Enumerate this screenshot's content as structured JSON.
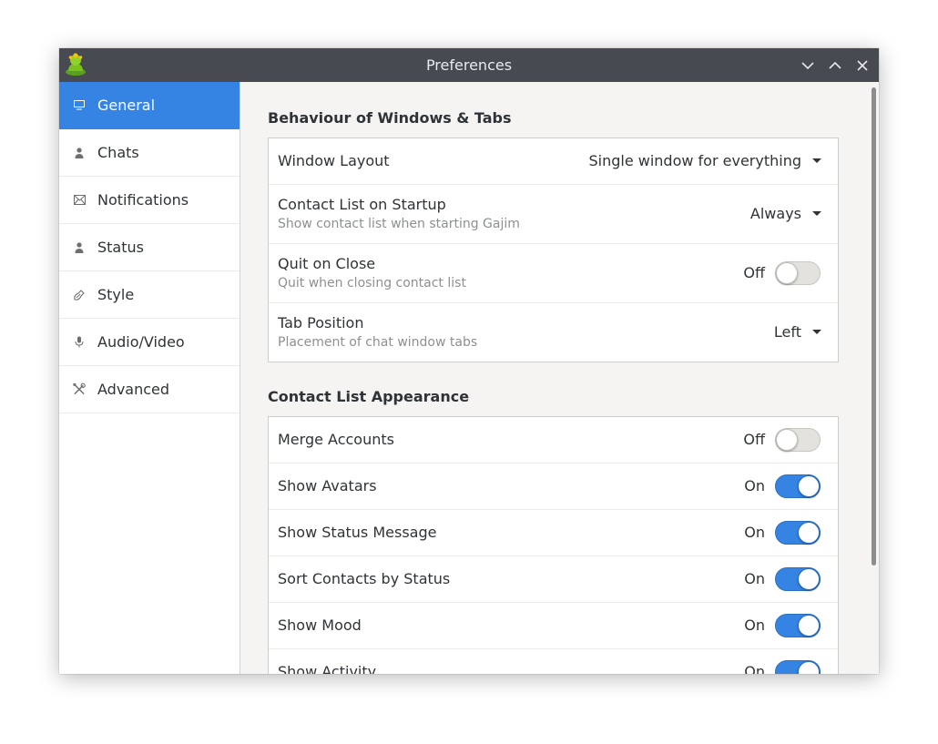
{
  "window": {
    "title": "Preferences",
    "app_icon": "gajim-icon",
    "controls": [
      "minimize-icon",
      "maximize-icon",
      "close-icon"
    ]
  },
  "sidebar": {
    "items": [
      {
        "label": "General",
        "icon": "monitor-icon",
        "active": true
      },
      {
        "label": "Chats",
        "icon": "person-icon",
        "active": false
      },
      {
        "label": "Notifications",
        "icon": "envelope-icon",
        "active": false
      },
      {
        "label": "Status",
        "icon": "person-icon",
        "active": false
      },
      {
        "label": "Style",
        "icon": "brush-icon",
        "active": false
      },
      {
        "label": "Audio/Video",
        "icon": "microphone-icon",
        "active": false
      },
      {
        "label": "Advanced",
        "icon": "tools-icon",
        "active": false
      }
    ]
  },
  "sections": {
    "windows": {
      "title": "Behaviour of Windows & Tabs",
      "rows": [
        {
          "label": "Window Layout",
          "value": "Single window for everything"
        },
        {
          "label": "Contact List on Startup",
          "sub": "Show contact list when starting Gajim",
          "value": "Always"
        },
        {
          "label": "Quit on Close",
          "sub": "Quit when closing contact list",
          "state": "Off"
        },
        {
          "label": "Tab Position",
          "sub": "Placement of chat window tabs",
          "value": "Left"
        }
      ]
    },
    "contacts": {
      "title": "Contact List Appearance",
      "rows": [
        {
          "label": "Merge Accounts",
          "state": "Off"
        },
        {
          "label": "Show Avatars",
          "state": "On"
        },
        {
          "label": "Show Status Message",
          "state": "On"
        },
        {
          "label": "Sort Contacts by Status",
          "state": "On"
        },
        {
          "label": "Show Mood",
          "state": "On"
        },
        {
          "label": "Show Activity",
          "state": "On"
        }
      ]
    }
  },
  "colors": {
    "accent": "#3584e4",
    "titlebar": "#474b51"
  }
}
